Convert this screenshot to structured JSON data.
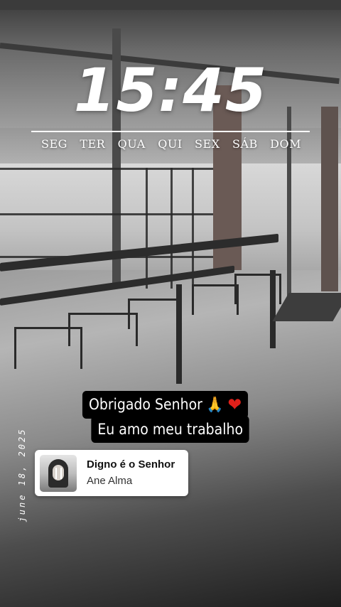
{
  "story": {
    "clock": {
      "time": "15:45"
    },
    "weekdays": [
      {
        "label": "SEG",
        "active": false
      },
      {
        "label": "TER",
        "active": false
      },
      {
        "label": "QUA",
        "active": true
      },
      {
        "label": "QUI",
        "active": false
      },
      {
        "label": "SEX",
        "active": false
      },
      {
        "label": "SÁB",
        "active": false
      },
      {
        "label": "DOM",
        "active": false
      }
    ],
    "highlight_color": "#ff6a13",
    "caption": {
      "line1": "Obrigado Senhor",
      "line1_emojis": {
        "pray": "🙏",
        "heart": "❤"
      },
      "line2": "Eu amo meu trabalho"
    },
    "music": {
      "title": "Digno é o Senhor",
      "artist": "Ane Alma"
    },
    "date_stamp": "june 18, 2025"
  }
}
